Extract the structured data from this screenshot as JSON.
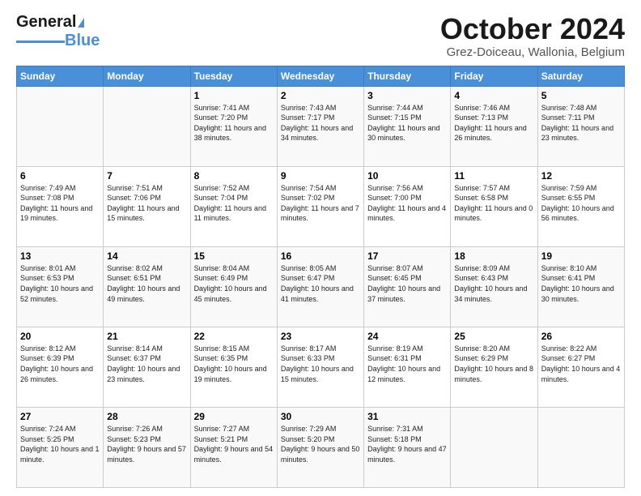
{
  "logo": {
    "line1": "General",
    "line2": "Blue"
  },
  "title": "October 2024",
  "location": "Grez-Doiceau, Wallonia, Belgium",
  "days_of_week": [
    "Sunday",
    "Monday",
    "Tuesday",
    "Wednesday",
    "Thursday",
    "Friday",
    "Saturday"
  ],
  "weeks": [
    [
      {
        "day": "",
        "sunrise": "",
        "sunset": "",
        "daylight": ""
      },
      {
        "day": "",
        "sunrise": "",
        "sunset": "",
        "daylight": ""
      },
      {
        "day": "1",
        "sunrise": "Sunrise: 7:41 AM",
        "sunset": "Sunset: 7:20 PM",
        "daylight": "Daylight: 11 hours and 38 minutes."
      },
      {
        "day": "2",
        "sunrise": "Sunrise: 7:43 AM",
        "sunset": "Sunset: 7:17 PM",
        "daylight": "Daylight: 11 hours and 34 minutes."
      },
      {
        "day": "3",
        "sunrise": "Sunrise: 7:44 AM",
        "sunset": "Sunset: 7:15 PM",
        "daylight": "Daylight: 11 hours and 30 minutes."
      },
      {
        "day": "4",
        "sunrise": "Sunrise: 7:46 AM",
        "sunset": "Sunset: 7:13 PM",
        "daylight": "Daylight: 11 hours and 26 minutes."
      },
      {
        "day": "5",
        "sunrise": "Sunrise: 7:48 AM",
        "sunset": "Sunset: 7:11 PM",
        "daylight": "Daylight: 11 hours and 23 minutes."
      }
    ],
    [
      {
        "day": "6",
        "sunrise": "Sunrise: 7:49 AM",
        "sunset": "Sunset: 7:08 PM",
        "daylight": "Daylight: 11 hours and 19 minutes."
      },
      {
        "day": "7",
        "sunrise": "Sunrise: 7:51 AM",
        "sunset": "Sunset: 7:06 PM",
        "daylight": "Daylight: 11 hours and 15 minutes."
      },
      {
        "day": "8",
        "sunrise": "Sunrise: 7:52 AM",
        "sunset": "Sunset: 7:04 PM",
        "daylight": "Daylight: 11 hours and 11 minutes."
      },
      {
        "day": "9",
        "sunrise": "Sunrise: 7:54 AM",
        "sunset": "Sunset: 7:02 PM",
        "daylight": "Daylight: 11 hours and 7 minutes."
      },
      {
        "day": "10",
        "sunrise": "Sunrise: 7:56 AM",
        "sunset": "Sunset: 7:00 PM",
        "daylight": "Daylight: 11 hours and 4 minutes."
      },
      {
        "day": "11",
        "sunrise": "Sunrise: 7:57 AM",
        "sunset": "Sunset: 6:58 PM",
        "daylight": "Daylight: 11 hours and 0 minutes."
      },
      {
        "day": "12",
        "sunrise": "Sunrise: 7:59 AM",
        "sunset": "Sunset: 6:55 PM",
        "daylight": "Daylight: 10 hours and 56 minutes."
      }
    ],
    [
      {
        "day": "13",
        "sunrise": "Sunrise: 8:01 AM",
        "sunset": "Sunset: 6:53 PM",
        "daylight": "Daylight: 10 hours and 52 minutes."
      },
      {
        "day": "14",
        "sunrise": "Sunrise: 8:02 AM",
        "sunset": "Sunset: 6:51 PM",
        "daylight": "Daylight: 10 hours and 49 minutes."
      },
      {
        "day": "15",
        "sunrise": "Sunrise: 8:04 AM",
        "sunset": "Sunset: 6:49 PM",
        "daylight": "Daylight: 10 hours and 45 minutes."
      },
      {
        "day": "16",
        "sunrise": "Sunrise: 8:05 AM",
        "sunset": "Sunset: 6:47 PM",
        "daylight": "Daylight: 10 hours and 41 minutes."
      },
      {
        "day": "17",
        "sunrise": "Sunrise: 8:07 AM",
        "sunset": "Sunset: 6:45 PM",
        "daylight": "Daylight: 10 hours and 37 minutes."
      },
      {
        "day": "18",
        "sunrise": "Sunrise: 8:09 AM",
        "sunset": "Sunset: 6:43 PM",
        "daylight": "Daylight: 10 hours and 34 minutes."
      },
      {
        "day": "19",
        "sunrise": "Sunrise: 8:10 AM",
        "sunset": "Sunset: 6:41 PM",
        "daylight": "Daylight: 10 hours and 30 minutes."
      }
    ],
    [
      {
        "day": "20",
        "sunrise": "Sunrise: 8:12 AM",
        "sunset": "Sunset: 6:39 PM",
        "daylight": "Daylight: 10 hours and 26 minutes."
      },
      {
        "day": "21",
        "sunrise": "Sunrise: 8:14 AM",
        "sunset": "Sunset: 6:37 PM",
        "daylight": "Daylight: 10 hours and 23 minutes."
      },
      {
        "day": "22",
        "sunrise": "Sunrise: 8:15 AM",
        "sunset": "Sunset: 6:35 PM",
        "daylight": "Daylight: 10 hours and 19 minutes."
      },
      {
        "day": "23",
        "sunrise": "Sunrise: 8:17 AM",
        "sunset": "Sunset: 6:33 PM",
        "daylight": "Daylight: 10 hours and 15 minutes."
      },
      {
        "day": "24",
        "sunrise": "Sunrise: 8:19 AM",
        "sunset": "Sunset: 6:31 PM",
        "daylight": "Daylight: 10 hours and 12 minutes."
      },
      {
        "day": "25",
        "sunrise": "Sunrise: 8:20 AM",
        "sunset": "Sunset: 6:29 PM",
        "daylight": "Daylight: 10 hours and 8 minutes."
      },
      {
        "day": "26",
        "sunrise": "Sunrise: 8:22 AM",
        "sunset": "Sunset: 6:27 PM",
        "daylight": "Daylight: 10 hours and 4 minutes."
      }
    ],
    [
      {
        "day": "27",
        "sunrise": "Sunrise: 7:24 AM",
        "sunset": "Sunset: 5:25 PM",
        "daylight": "Daylight: 10 hours and 1 minute."
      },
      {
        "day": "28",
        "sunrise": "Sunrise: 7:26 AM",
        "sunset": "Sunset: 5:23 PM",
        "daylight": "Daylight: 9 hours and 57 minutes."
      },
      {
        "day": "29",
        "sunrise": "Sunrise: 7:27 AM",
        "sunset": "Sunset: 5:21 PM",
        "daylight": "Daylight: 9 hours and 54 minutes."
      },
      {
        "day": "30",
        "sunrise": "Sunrise: 7:29 AM",
        "sunset": "Sunset: 5:20 PM",
        "daylight": "Daylight: 9 hours and 50 minutes."
      },
      {
        "day": "31",
        "sunrise": "Sunrise: 7:31 AM",
        "sunset": "Sunset: 5:18 PM",
        "daylight": "Daylight: 9 hours and 47 minutes."
      },
      {
        "day": "",
        "sunrise": "",
        "sunset": "",
        "daylight": ""
      },
      {
        "day": "",
        "sunrise": "",
        "sunset": "",
        "daylight": ""
      }
    ]
  ]
}
